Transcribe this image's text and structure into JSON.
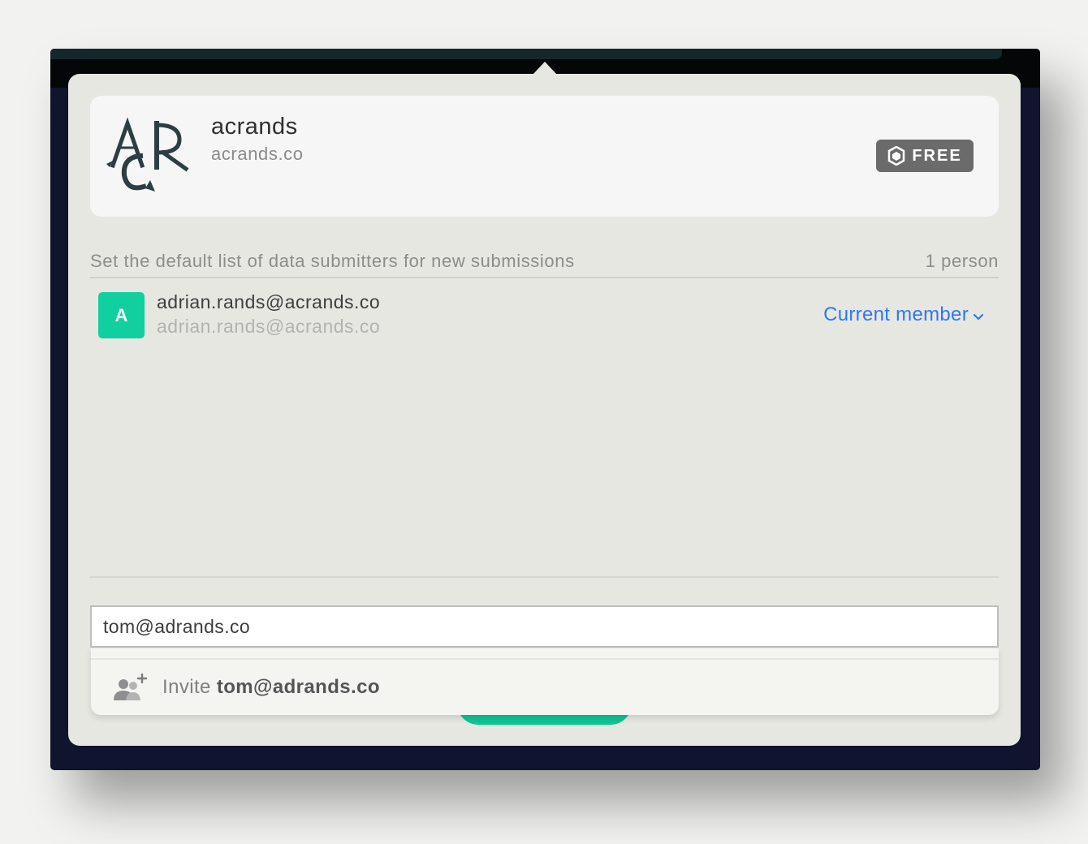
{
  "org": {
    "name": "acrands",
    "domain": "acrands.co",
    "logo_alt": "ACR monogram logo",
    "plan_label": "FREE"
  },
  "submitters": {
    "title": "Set the default list of data submitters for new submissions",
    "count_label": "1 person",
    "members": [
      {
        "avatar_letter": "A",
        "avatar_color": "#12cf9f",
        "primary": "adrian.rands@acrands.co",
        "secondary": "adrian.rands@acrands.co",
        "role": "Current member"
      }
    ]
  },
  "invite": {
    "input_value": "tom@adrands.co",
    "suggestion_prefix": "Invite",
    "suggestion_email": "tom@adrands.co"
  },
  "colors": {
    "accent_green": "#0fc495",
    "link_blue": "#2f78f0",
    "app_background": "#10142c"
  },
  "icons": {
    "plan": "shield-icon",
    "role_dropdown": "chevron-down-icon",
    "invite": "add-user-icon"
  }
}
